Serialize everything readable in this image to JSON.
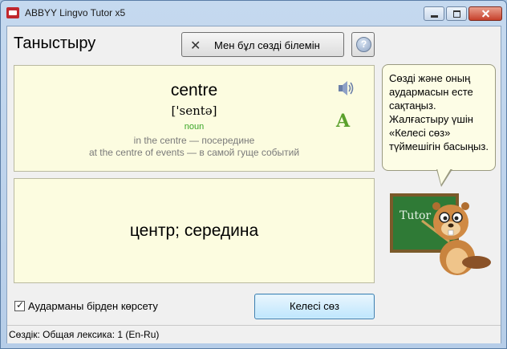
{
  "window": {
    "title": "ABBYY Lingvo Tutor x5"
  },
  "header": {
    "page_title": "Таныстыру",
    "know_button_label": "Мен бұл сөзді білемін"
  },
  "word_card": {
    "word": "centre",
    "transcription": "['sentə]",
    "part_of_speech": "noun",
    "examples": [
      "in the centre — посередине",
      "at the centre of events — в самой гуще событий"
    ]
  },
  "translation_card": {
    "translation": "центр; середина"
  },
  "hint_bubble": {
    "text": "Сөзді және оның аудармасын есте сақтаңыз. Жалғастыру үшін «Келесі сөз» түймешігін басыңыз."
  },
  "mascot": {
    "board_text": "Tutor"
  },
  "footer": {
    "show_translation_label": "Аударманы бірден көрсету",
    "show_translation_checked": true,
    "next_button_label": "Келесі сөз"
  },
  "status_bar": {
    "text": "Сөздік: Общая лексика: 1 (En-Ru)"
  },
  "colors": {
    "card_bg": "#fcfce0",
    "pos_green": "#3aa526",
    "example_gray": "#7a7a7a"
  },
  "icons": [
    "app-icon",
    "close-x-icon",
    "help-icon",
    "speaker-icon",
    "font-a-icon",
    "check-icon"
  ]
}
